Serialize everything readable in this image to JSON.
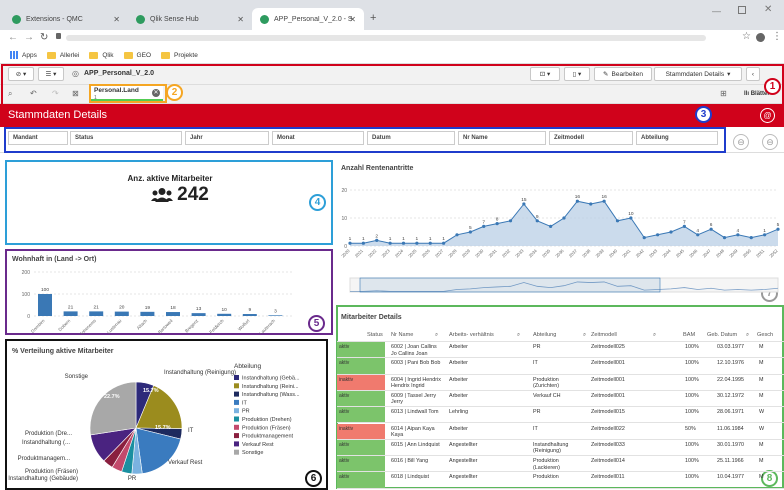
{
  "browser": {
    "tabs": [
      {
        "title": "Extensions - QMC"
      },
      {
        "title": "Qlik Sense Hub"
      },
      {
        "title": "APP_Personal_V_2.0 - Stammdat"
      }
    ],
    "new_tab": "+",
    "bookmarks": [
      "Apps",
      "Allerlei",
      "Qlik",
      "GEO",
      "Projekte"
    ]
  },
  "toolbar": {
    "app_name": "APP_Personal_V_2.0",
    "edit_label": "Bearbeiten",
    "sheet_selector": "Stammdaten Details",
    "selection_chip": "Personal.Land",
    "selection_sub": "1",
    "sheets_label": "Blätter"
  },
  "sheet": {
    "title": "Stammdaten Details"
  },
  "filters": [
    "Mandant",
    "Status",
    "Jahr",
    "Monat",
    "Datum",
    "Nr Name",
    "Zeitmodell",
    "Abteilung"
  ],
  "badges": [
    "1",
    "2",
    "3",
    "4",
    "5",
    "6",
    "7",
    "8"
  ],
  "colors": {
    "red": "#d0021b",
    "orange": "#f5a623",
    "blue_badge": "#1f3ccc",
    "cyan": "#2d9fd8",
    "purple": "#6a2a8c",
    "black": "#111111",
    "grey": "#999999",
    "green": "#5cb85c",
    "kpi_bar": "#3a78b5"
  },
  "kpi": {
    "label": "Anz. aktive Mitarbeiter",
    "value": "242",
    "icon": "users-icon"
  },
  "wohnhaft": {
    "title": "Wohnhaft in (Land -> Ort)",
    "chart_data": {
      "type": "bar",
      "categories": [
        "Dornbirn",
        "Dobern",
        "Hohenems",
        "Lustenau",
        "Altach",
        "Bartoweil",
        "Bregenz",
        "Feldkirch",
        "Wolfurt",
        "Lauterach"
      ],
      "values": [
        100,
        21,
        21,
        20,
        19,
        18,
        13,
        10,
        9,
        3
      ],
      "value_labels": [
        "100",
        "21",
        "21",
        "20",
        "19",
        "18",
        "13",
        "10",
        "9",
        "3"
      ],
      "yticks": [
        "200",
        "100",
        "0"
      ],
      "ylim": [
        0,
        200
      ],
      "color": "#3a78b5"
    }
  },
  "renten": {
    "title": "Anzahl Rentenantritte",
    "chart_data": {
      "type": "area",
      "x": [
        "2020",
        "2021",
        "2022",
        "2023",
        "2024",
        "2025",
        "2026",
        "2027",
        "2028",
        "2029",
        "2030",
        "2031",
        "2032",
        "2033",
        "2034",
        "2035",
        "2036",
        "2037",
        "2038",
        "2039",
        "2040",
        "2041",
        "2042",
        "2043",
        "2044",
        "2045",
        "2046",
        "2047",
        "2048",
        "2049",
        "2050",
        "2051",
        "2052"
      ],
      "values": [
        1,
        1,
        2,
        1,
        1,
        1,
        1,
        1,
        4,
        5,
        7,
        8,
        9,
        15,
        9,
        7,
        10,
        16,
        15,
        16,
        9,
        10,
        3,
        4,
        5,
        7,
        4,
        6,
        3,
        4,
        3,
        4,
        6
      ],
      "value_labels": [
        "1",
        "1",
        "2",
        "1",
        "1",
        "1",
        "1",
        "1",
        "",
        "5",
        "7",
        "8",
        "",
        "15",
        "9",
        "",
        "",
        "16",
        "",
        "16",
        "",
        "10",
        "",
        "",
        "",
        "7",
        "4",
        "6",
        "",
        "4",
        "",
        "1",
        "5"
      ],
      "yticks": [
        "20",
        "10",
        "0"
      ],
      "ylim": [
        0,
        20
      ],
      "color": "#3a78b5"
    }
  },
  "verteilung": {
    "title": "% Verteilung aktive Mitarbeiter",
    "legend_title": "Abteilung",
    "chart_data": {
      "type": "pie",
      "slices": [
        {
          "label": "Instandhaltung (Gebä...",
          "value": 5.2,
          "color": "#2d2a7a"
        },
        {
          "label": "Instandhaltung (Reini...",
          "value": 15.7,
          "color": "#9b8c1e"
        },
        {
          "label": "Instandhaltung (Wass...",
          "value": 3.0,
          "color": "#1d2a5e"
        },
        {
          "label": "IT",
          "value": 15.7,
          "color": "#3a7bbf"
        },
        {
          "label": "PR",
          "value": 3.0,
          "color": "#7ab2e0"
        },
        {
          "label": "Produktion (Drehen)",
          "value": 3.0,
          "color": "#1a8fa0"
        },
        {
          "label": "Produktion (Fräsen)",
          "value": 3.0,
          "color": "#c34a6c"
        },
        {
          "label": "Produktmanagement",
          "value": 3.0,
          "color": "#8a1f3f"
        },
        {
          "label": "Verkauf Rest",
          "value": 8.5,
          "color": "#4a2380"
        },
        {
          "label": "Sonstige",
          "value": 22.7,
          "color": "#a8a8a8"
        }
      ],
      "outer_labels": [
        "Instandhaltung (Reinigung)",
        "IT",
        "Verkauf Rest",
        "PR",
        "Instandhaltung (Gebäude)",
        "Produktion (Fräsen)",
        "Produktmanagem...",
        "Instandhaltung (...",
        "Produktion (Dre...",
        "Sonstige"
      ],
      "pct_labels": [
        "15.7%",
        "15.7%",
        "22.7%"
      ]
    }
  },
  "details": {
    "title": "Mitarbeiter Details",
    "columns": [
      "Status",
      "Nr Name",
      "Arbeits- verhältnis",
      "Abteilung",
      "Zeitmodell",
      "BAM",
      "Geb. Datum",
      "Gesch"
    ],
    "rows": [
      {
        "status": "aktiv",
        "name": "6002 | Joan Callins Jo Callins Joan",
        "verh": "Arbeiter",
        "abt": "PR",
        "zeit": "Zeitmodell025",
        "bam": "100%",
        "geb": "03.03.1977",
        "g": "M"
      },
      {
        "status": "aktiv",
        "name": "6003 | Pani Bob Bob",
        "verh": "Arbeiter",
        "abt": "IT",
        "zeit": "Zeitmodell001",
        "bam": "100%",
        "geb": "12.10.1976",
        "g": "M"
      },
      {
        "status": "inaktiv",
        "name": "6004 | Ingrid Hendrix Hendrix Ingrid",
        "verh": "Arbeiter",
        "abt": "Produktion (Zurichten)",
        "zeit": "Zeitmodell001",
        "bam": "100%",
        "geb": "22.04.1995",
        "g": "M"
      },
      {
        "status": "aktiv",
        "name": "6009 | Tassel Jerry Jerry",
        "verh": "Arbeiter",
        "abt": "Verkauf CH",
        "zeit": "Zeitmodell001",
        "bam": "100%",
        "geb": "30.12.1972",
        "g": "M"
      },
      {
        "status": "aktiv",
        "name": "6013 | Lindwall Tom",
        "verh": "Lehrling",
        "abt": "PR",
        "zeit": "Zeitmodell015",
        "bam": "100%",
        "geb": "28.06.1971",
        "g": "W"
      },
      {
        "status": "inaktiv",
        "name": "6014 | Aipan Kaya Kaya",
        "verh": "Arbeiter",
        "abt": "IT",
        "zeit": "Zeitmodell022",
        "bam": "50%",
        "geb": "11.06.1984",
        "g": "W"
      },
      {
        "status": "aktiv",
        "name": "6015 | Ann Lindquist",
        "verh": "Angestellter",
        "abt": "Instandhaltung (Reinigung)",
        "zeit": "Zeitmodell033",
        "bam": "100%",
        "geb": "30.01.1970",
        "g": "M"
      },
      {
        "status": "aktiv",
        "name": "6016 | Bill Yang",
        "verh": "Angestellter",
        "abt": "Produktion (Lackieren)",
        "zeit": "Zeitmodell014",
        "bam": "100%",
        "geb": "25.11.1966",
        "g": "M"
      },
      {
        "status": "aktiv",
        "name": "6018 | Lindquist",
        "verh": "Angestellter",
        "abt": "Produktion",
        "zeit": "Zeitmodell011",
        "bam": "100%",
        "geb": "10.04.1977",
        "g": "M"
      }
    ]
  }
}
